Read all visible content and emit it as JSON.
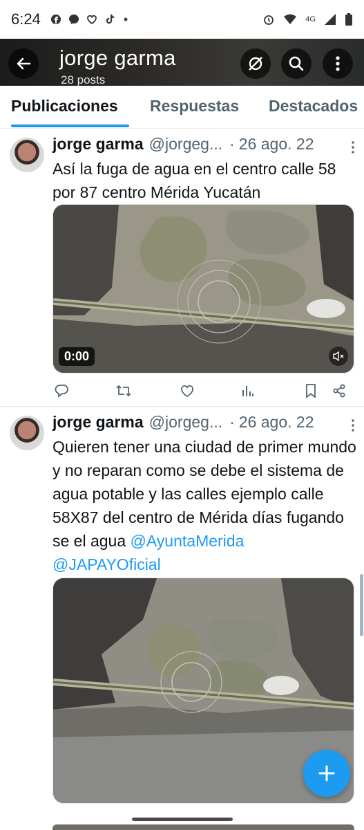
{
  "status_bar": {
    "time": "6:24",
    "network_label": "4G",
    "notification_icons": [
      "facebook-icon",
      "messenger-icon",
      "heart-chat-icon",
      "tiktok-icon",
      "dot-icon"
    ],
    "system_icons": [
      "alarm-icon",
      "wifi-icon",
      "signal-icon",
      "battery-icon"
    ]
  },
  "header": {
    "title": "jorge garma",
    "subtitle": "28 posts",
    "buttons": [
      "back-arrow-icon",
      "grok-icon",
      "search-icon",
      "more-vertical-icon"
    ]
  },
  "tabs": [
    {
      "label": "Publicaciones",
      "active": true
    },
    {
      "label": "Respuestas",
      "active": false
    },
    {
      "label": "Destacados",
      "active": false
    }
  ],
  "posts": [
    {
      "author": "jorge garma",
      "handle": "@jorgeg...",
      "separator": "·",
      "date": "26 ago. 22",
      "text": "Así la fuga de agua en el centro calle 58 por 87 centro Mérida Yucatán",
      "video_duration": "0:00",
      "media_type": "video",
      "actions": [
        "reply-icon",
        "repost-icon",
        "like-icon",
        "views-icon",
        "bookmark-icon",
        "share-icon"
      ]
    },
    {
      "author": "jorge garma",
      "handle": "@jorgeg...",
      "separator": "·",
      "date": "26 ago. 22",
      "text": "Quieren tener una ciudad de primer mundo y no reparan como se debe el sistema de agua potable y las calles ejemplo calle 58X87 del centro de Mérida días fugando se el agua",
      "mentions": [
        "@AyuntaMerida",
        "@JAPAYOficial"
      ],
      "media_type": "photo"
    }
  ],
  "fab": {
    "icon": "plus-icon"
  },
  "colors": {
    "accent": "#1d9bf0",
    "text_primary": "#0f1419",
    "text_secondary": "#536471",
    "divider": "#e6e8ea"
  }
}
